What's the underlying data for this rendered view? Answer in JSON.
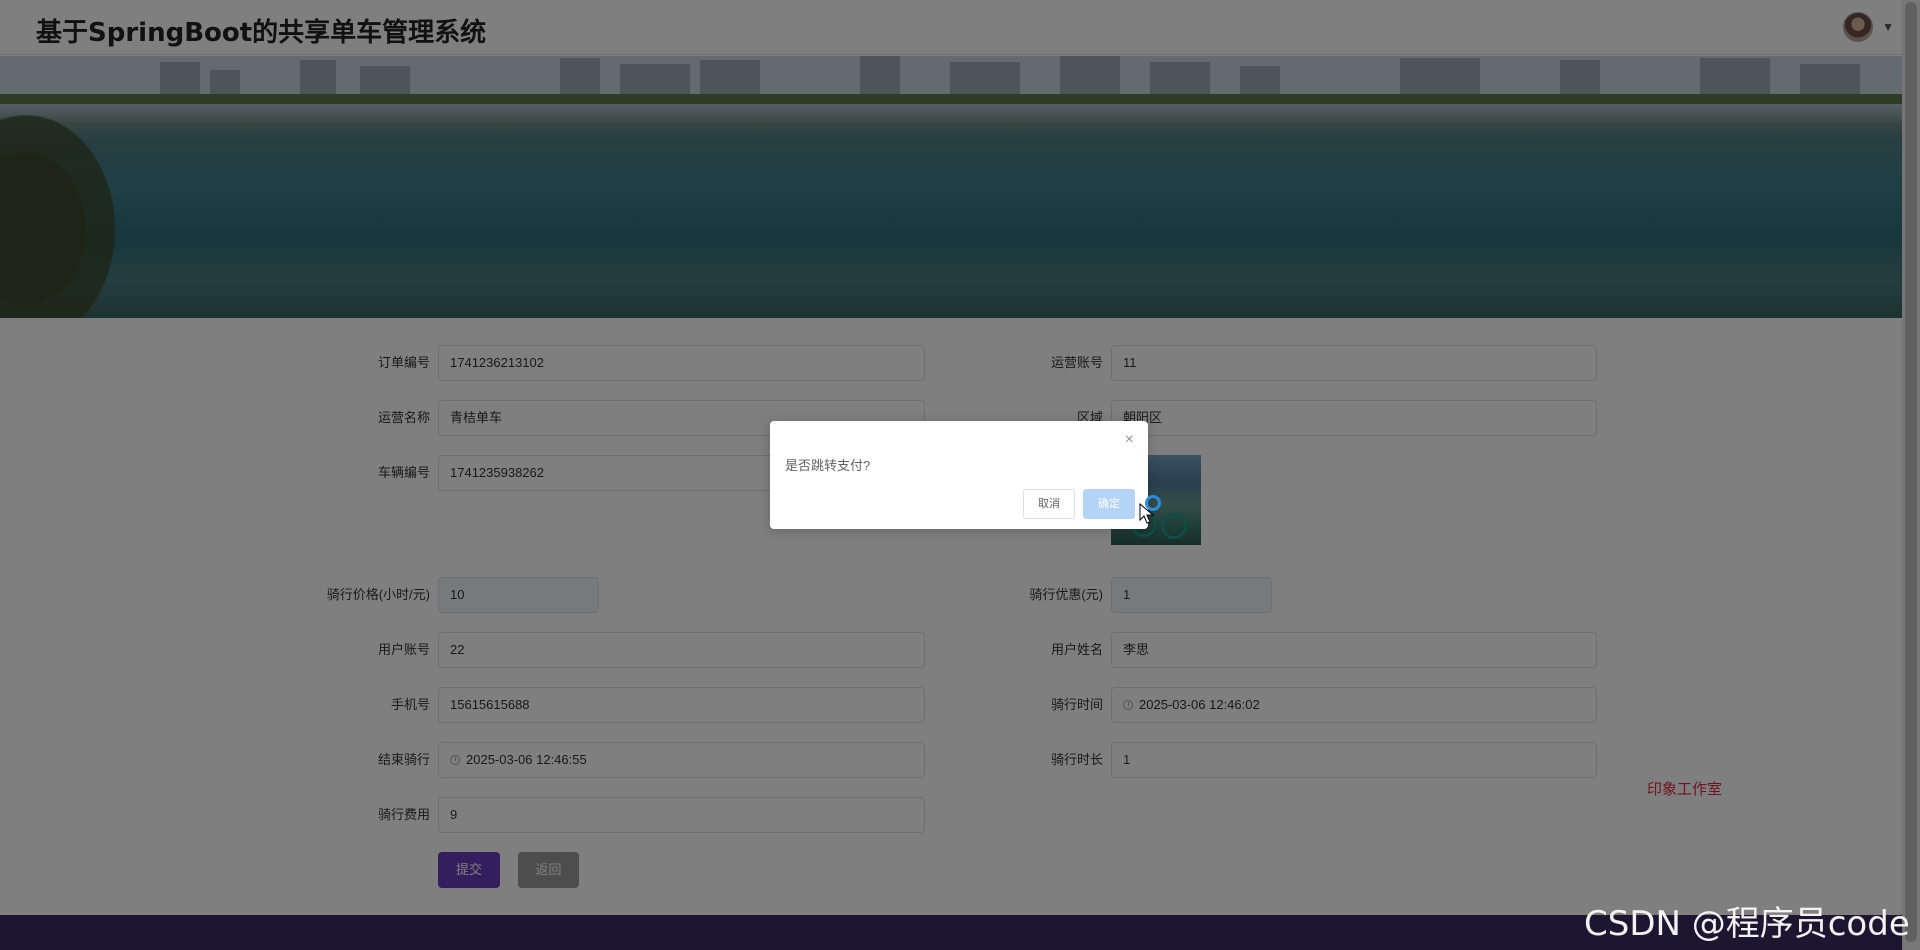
{
  "header": {
    "title": "基于SpringBoot的共享单车管理系统"
  },
  "form": {
    "order_no": {
      "label": "订单编号",
      "value": "1741236213102"
    },
    "operator_account": {
      "label": "运营账号",
      "value": "11"
    },
    "operator_name": {
      "label": "运营名称",
      "value": "青桔单车"
    },
    "region": {
      "label": "区域",
      "value": "朝阳区"
    },
    "bike_no": {
      "label": "车辆编号",
      "value": "1741235938262"
    },
    "ride_price": {
      "label": "骑行价格(小时/元)",
      "value": "10"
    },
    "ride_discount": {
      "label": "骑行优惠(元)",
      "value": "1"
    },
    "user_account": {
      "label": "用户账号",
      "value": "22"
    },
    "user_name": {
      "label": "用户姓名",
      "value": "李思"
    },
    "phone": {
      "label": "手机号",
      "value": "15615615688"
    },
    "ride_time": {
      "label": "骑行时间",
      "value": "2025-03-06 12:46:02"
    },
    "end_ride": {
      "label": "结束骑行",
      "value": "2025-03-06 12:46:55"
    },
    "ride_duration": {
      "label": "骑行时长",
      "value": "1"
    },
    "ride_fee": {
      "label": "骑行费用",
      "value": "9"
    },
    "submit_label": "提交",
    "back_label": "返回"
  },
  "dialog": {
    "message": "是否跳转支付?",
    "cancel_label": "取消",
    "confirm_label": "确定",
    "close_glyph": "×"
  },
  "watermarks": {
    "studio": "印象工作室",
    "csdn": "CSDN @程序员code"
  },
  "colors": {
    "primary": "#6a3cbc",
    "footer": "#3c2a63",
    "dialog_ok": "#b3d3f7",
    "studio": "#e0263a"
  },
  "icons": {
    "avatar": "user-avatar",
    "caret": "caret-down-icon",
    "clock": "clock-icon",
    "close": "close-icon",
    "cursor": "mouse-cursor"
  }
}
